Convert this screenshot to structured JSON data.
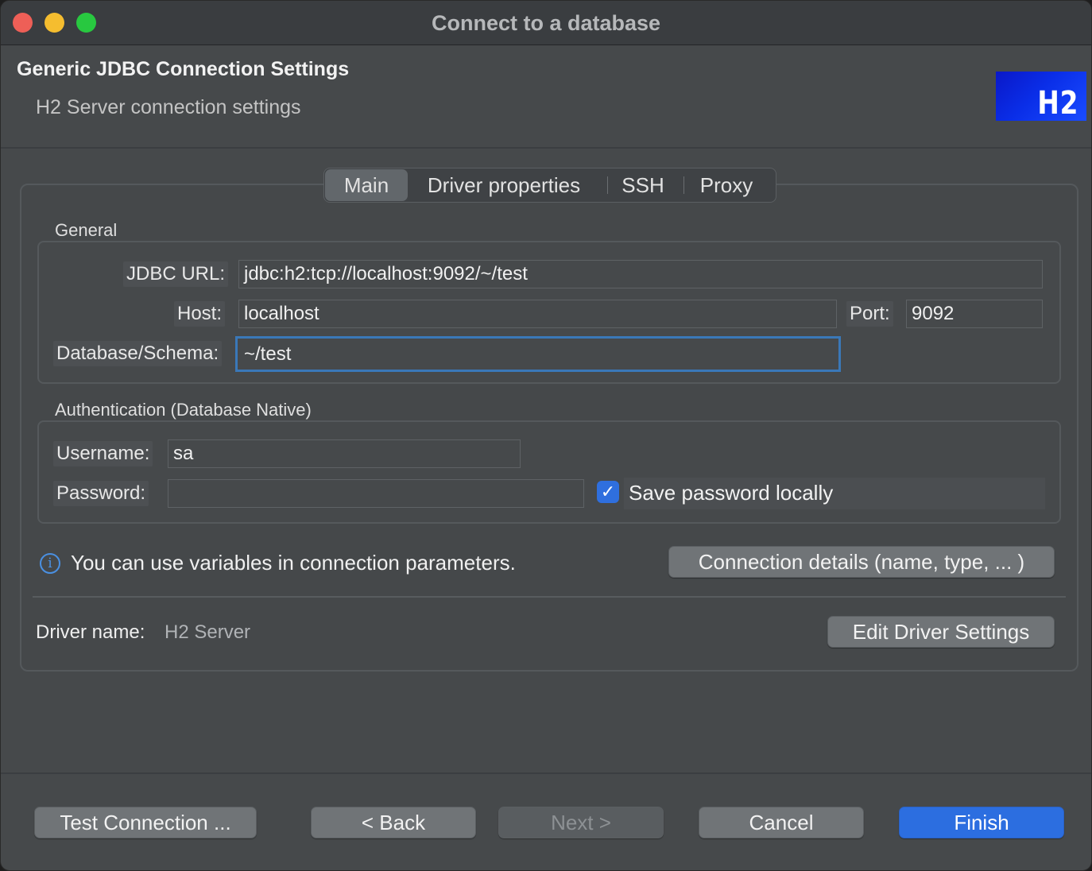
{
  "window": {
    "title": "Connect to a database"
  },
  "header": {
    "title": "Generic JDBC Connection Settings",
    "subtitle": "H2 Server connection settings",
    "logo_text": "H2"
  },
  "tabs": [
    {
      "label": "Main",
      "active": true
    },
    {
      "label": "Driver properties",
      "active": false
    },
    {
      "label": "SSH",
      "active": false
    },
    {
      "label": "Proxy",
      "active": false
    }
  ],
  "general": {
    "section_label": "General",
    "jdbc_url_label": "JDBC URL:",
    "jdbc_url_value": "jdbc:h2:tcp://localhost:9092/~/test",
    "host_label": "Host:",
    "host_value": "localhost",
    "port_label": "Port:",
    "port_value": "9092",
    "database_label": "Database/Schema:",
    "database_value": "~/test"
  },
  "auth": {
    "section_label": "Authentication (Database Native)",
    "username_label": "Username:",
    "username_value": "sa",
    "password_label": "Password:",
    "password_value": "",
    "save_password_label": "Save password locally",
    "save_password_checked": true
  },
  "info": {
    "icon": "info-icon",
    "text": "You can use variables in connection parameters.",
    "details_button": "Connection details (name, type, ... )"
  },
  "driver": {
    "label": "Driver name:",
    "value": "H2 Server",
    "edit_button": "Edit Driver Settings"
  },
  "footer": {
    "test_connection": "Test Connection ...",
    "back": "< Back",
    "next": "Next >",
    "cancel": "Cancel",
    "finish": "Finish"
  },
  "colors": {
    "accent": "#2c6ee0",
    "focus_ring": "#3a78b8",
    "window_bg": "#46494b"
  }
}
